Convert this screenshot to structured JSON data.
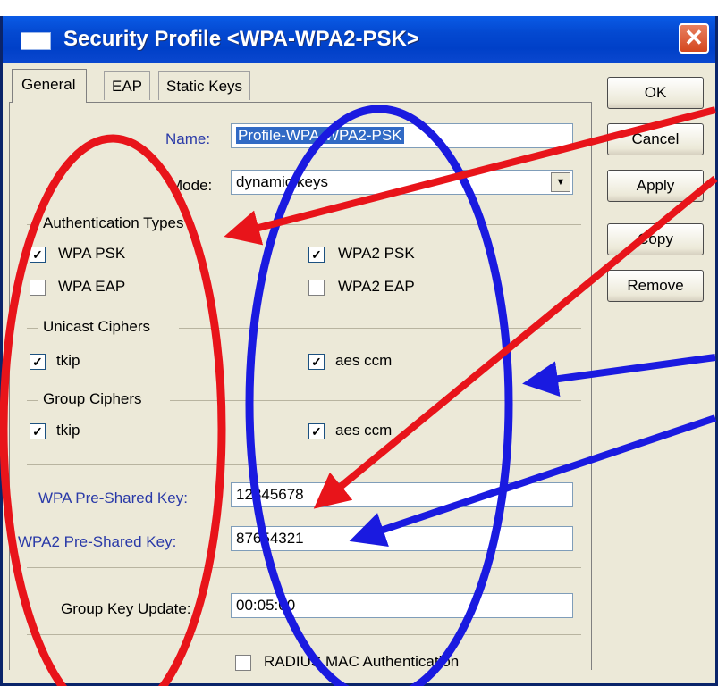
{
  "window": {
    "title": "Security Profile <WPA-WPA2-PSK>",
    "close_glyph": "✕"
  },
  "tabs": [
    {
      "label": "General"
    },
    {
      "label": "EAP"
    },
    {
      "label": "Static Keys"
    }
  ],
  "form": {
    "name_label": "Name:",
    "name_value": "Profile-WPA-WPA2-PSK",
    "mode_label": "Mode:",
    "mode_value": "dynamic keys",
    "auth_group": "Authentication Types",
    "auth_options": [
      {
        "label": "WPA PSK",
        "checked": true
      },
      {
        "label": "WPA2 PSK",
        "checked": true
      },
      {
        "label": "WPA EAP",
        "checked": false
      },
      {
        "label": "WPA2 EAP",
        "checked": false
      }
    ],
    "unicast_group": "Unicast Ciphers",
    "unicast_options": [
      {
        "label": "tkip",
        "checked": true
      },
      {
        "label": "aes ccm",
        "checked": true
      }
    ],
    "group_group": "Group Ciphers",
    "group_options": [
      {
        "label": "tkip",
        "checked": true
      },
      {
        "label": "aes ccm",
        "checked": true
      }
    ],
    "wpa_psk_label": "WPA Pre-Shared Key:",
    "wpa_psk_value": "12345678",
    "wpa2_psk_label": "WPA2 Pre-Shared Key:",
    "wpa2_psk_value": "87654321",
    "gku_label": "Group Key Update:",
    "gku_value": "00:05:00",
    "radius_label": "RADIUS MAC Authentication",
    "radius_checked": false
  },
  "buttons": [
    {
      "label": "OK"
    },
    {
      "label": "Cancel"
    },
    {
      "label": "Apply"
    },
    {
      "label": "Copy"
    },
    {
      "label": "Remove"
    }
  ],
  "colors": {
    "title_bar": "#0449d1",
    "label_blue": "#2a3aa8",
    "annotation_red": "#e8141a",
    "annotation_blue": "#1a1ae0",
    "selection": "#316ac5"
  },
  "icons": {
    "window": "window-icon",
    "close": "close-icon",
    "dropdown": "chevron-down-icon",
    "check": "checkmark-icon"
  }
}
